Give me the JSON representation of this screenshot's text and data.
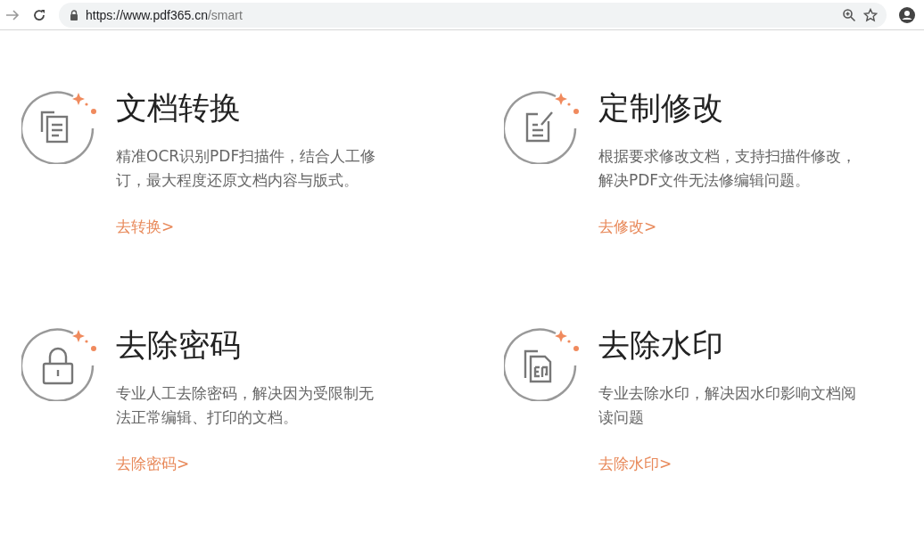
{
  "browser": {
    "url_host": "https://www.pdf365.cn",
    "url_path": "/smart"
  },
  "features": [
    {
      "kind": "documents",
      "title": "文档转换",
      "description": "精准OCR识别PDF扫描件，结合人工修订，最大程度还原文档内容与版式。",
      "link": "去转换>"
    },
    {
      "kind": "edit",
      "title": "定制修改",
      "description": "根据要求修改文档，支持扫描件修改，解决PDF文件无法修编辑问题。",
      "link": "去修改>"
    },
    {
      "kind": "lock",
      "title": "去除密码",
      "description": "专业人工去除密码，解决因为受限制无法正常编辑、打印的文档。",
      "link": "去除密码>"
    },
    {
      "kind": "watermark",
      "title": "去除水印",
      "description": "专业去除水印，解决因水印影响文档阅读问题",
      "link": "去除水印>"
    }
  ]
}
